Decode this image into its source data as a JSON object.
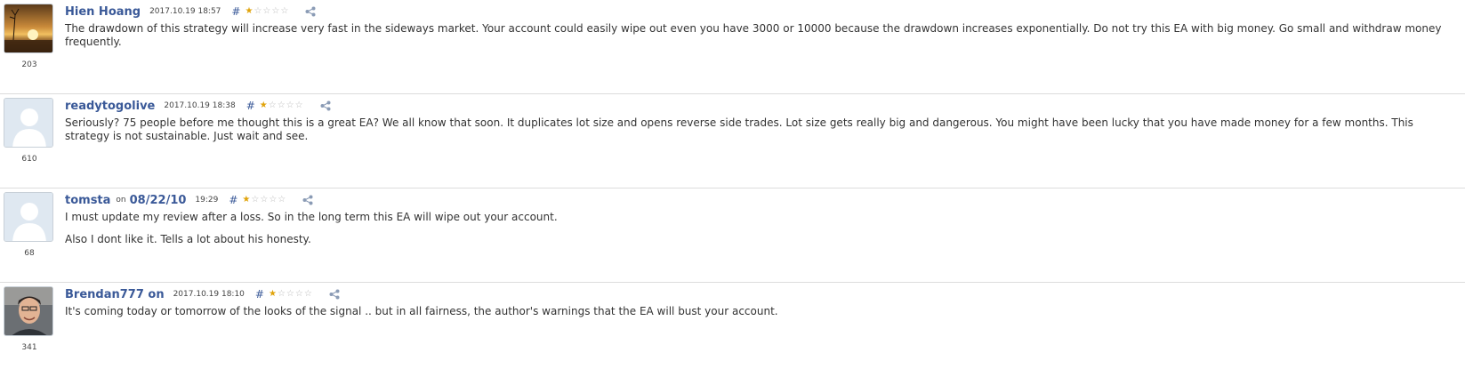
{
  "reviews": [
    {
      "author": "Hien Hoang",
      "on_label": "",
      "date_link": "",
      "timestamp": "2017.10.19 18:57",
      "hash": "#",
      "stars_filled": 1,
      "stars_total": 5,
      "rating_count": "203",
      "avatar": "sunset-photo",
      "paragraphs": [
        "The drawdown of this strategy will increase very fast in the sideways market. Your account could easily wipe out even you have 3000 or 10000 because the drawdown increases exponentially. Do not try this EA with big money. Go small and withdraw money frequently."
      ]
    },
    {
      "author": "readytogolive",
      "on_label": "",
      "date_link": "",
      "timestamp": "2017.10.19 18:38",
      "hash": "#",
      "stars_filled": 1,
      "stars_total": 5,
      "rating_count": "610",
      "avatar": "default-user-silhouette",
      "paragraphs": [
        "Seriously? 75 people before me thought this is a great EA? We all know that soon. It duplicates lot size and opens reverse side trades. Lot size gets really big and dangerous. You might have been lucky that you have made money for a few months. This strategy is not sustainable. Just wait and see."
      ]
    },
    {
      "author": "tomsta",
      "on_label": "on",
      "date_link": "08/22/10",
      "timestamp": "19:29",
      "hash": "#",
      "stars_filled": 1,
      "stars_total": 5,
      "rating_count": "68",
      "avatar": "default-user-silhouette",
      "paragraphs": [
        "I must update my review after a loss. So in the long term this EA will wipe out your account.",
        "Also I dont like it. Tells a lot about his honesty."
      ]
    },
    {
      "author": "Brendan777 on",
      "on_label": "",
      "date_link": "",
      "timestamp": "2017.10.19 18:10",
      "hash": "#",
      "stars_filled": 1,
      "stars_total": 5,
      "rating_count": "341",
      "avatar": "person-photo",
      "paragraphs": [
        "It's coming today or tomorrow of the looks of the signal .. but in all fairness, the author's warnings that the EA will bust your account."
      ]
    }
  ],
  "colors": {
    "author_link": "#3a5998",
    "star_filled": "#e0a30a",
    "star_empty": "#bbbbbb",
    "divider": "#dcdcdc"
  }
}
